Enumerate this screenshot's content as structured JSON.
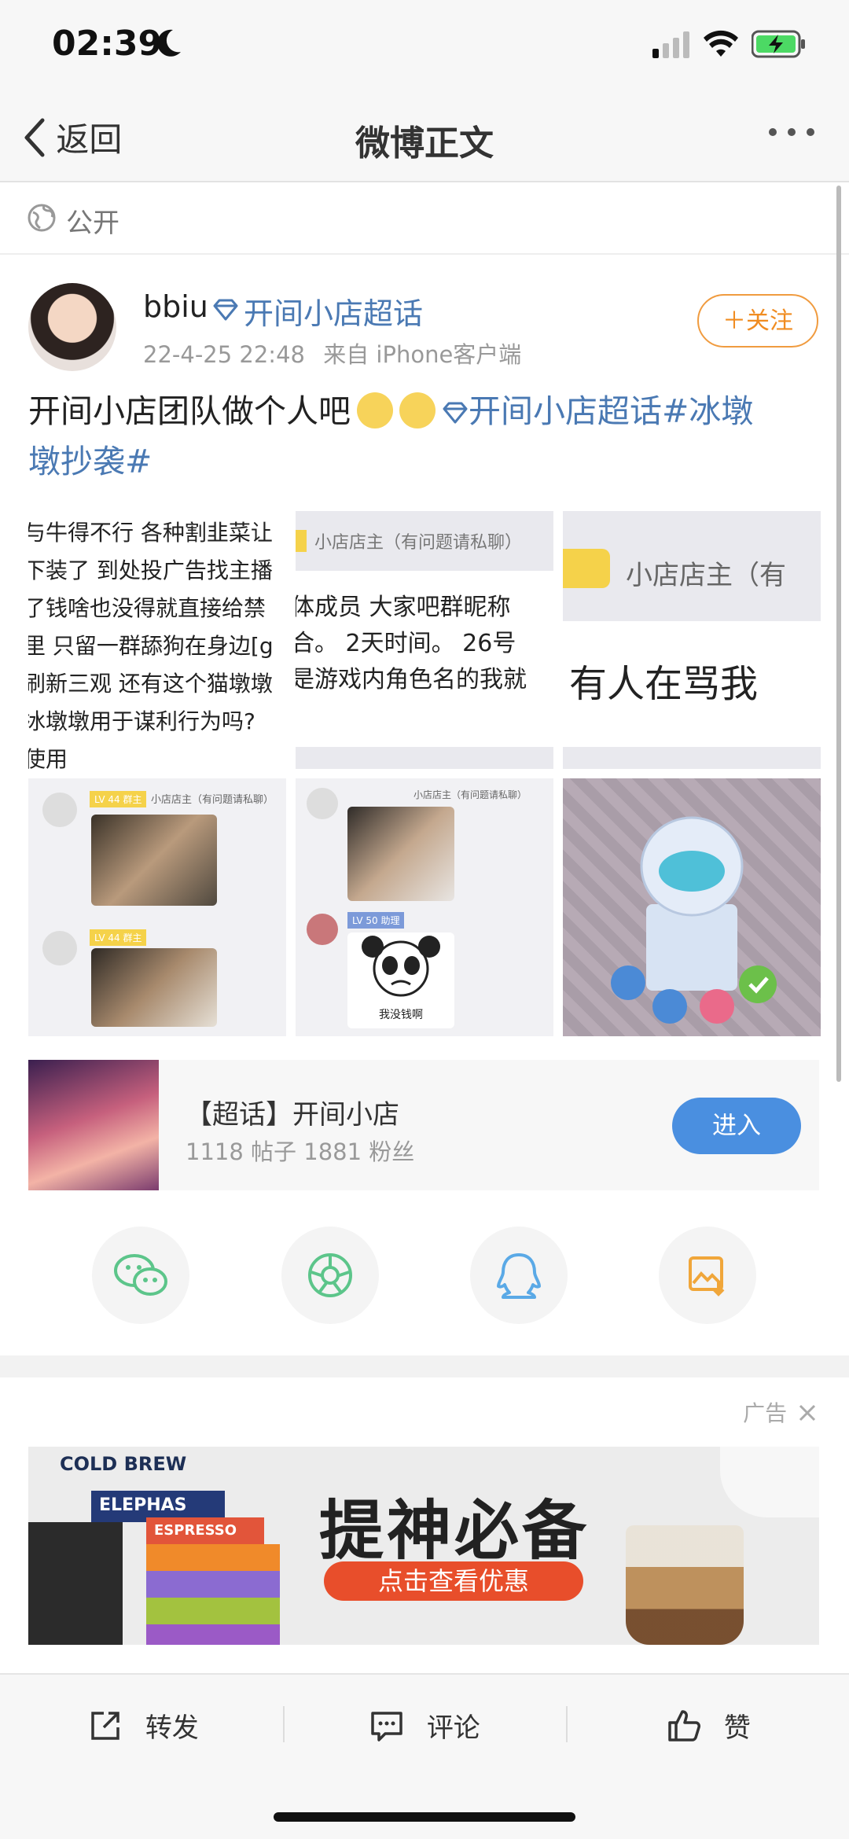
{
  "status_bar": {
    "time": "02:39"
  },
  "nav": {
    "back_label": "返回",
    "title": "微博正文"
  },
  "visibility": {
    "label": "公开"
  },
  "post": {
    "username": "bbiu",
    "topic_tag": "开间小店超话",
    "timestamp": "22-4-25 22:48",
    "source": "来自 iPhone客户端",
    "follow_label": "＋关注",
    "text_main": "开间小店团队做个人吧",
    "text_topic": "开间小店超话",
    "text_hashtag_part1": "#冰墩",
    "text_hashtag_part2": "墩抄袭#",
    "images": {
      "img1_lines": [
        "与牛得不行 各种割韭菜让",
        "下装了 到处投广告找主播",
        "了钱啥也没得就直接给禁",
        "里 只留一群舔狗在身边[g",
        "刷新三观 还有这个猫墩墩",
        "冰墩墩用于谋利行为吗?",
        "使用"
      ],
      "img2_header": "小店店主（有问题请私聊）",
      "img2_lines": [
        "体成员  大家吧群昵称",
        "合。 2天时间。 26号",
        "是游戏内角色名的我就"
      ],
      "img3_header": "小店店主（有",
      "img3_line": "有人在骂我",
      "img4_badge": "LV 44 群主",
      "img4_name": "小店店主（有问题请私聊）",
      "img5_badge": "LV 44 群主",
      "img5_name": "小店店主（有问题请私聊）",
      "img5_badge2": "LV 50 助理",
      "img5_caption": "我没钱啊"
    }
  },
  "supertopic": {
    "name": "【超话】开间小店",
    "stats": "1118 帖子  1881 粉丝",
    "enter_label": "进入"
  },
  "share": {
    "icons": [
      "wechat-icon",
      "moments-icon",
      "qq-icon",
      "save-image-icon"
    ],
    "colors": [
      "#5cc58a",
      "#5cc58a",
      "#5aa9e6",
      "#f0a63a"
    ]
  },
  "ad": {
    "label": "广告",
    "banner_headline": "提神必备",
    "banner_cta": "点击查看优惠",
    "brand_text_1": "COLD BREW",
    "brand_text_2": "ELEPHAS",
    "brand_text_3": "ESPRESSO"
  },
  "actions": {
    "repost": "转发",
    "comment": "评论",
    "like": "赞"
  }
}
